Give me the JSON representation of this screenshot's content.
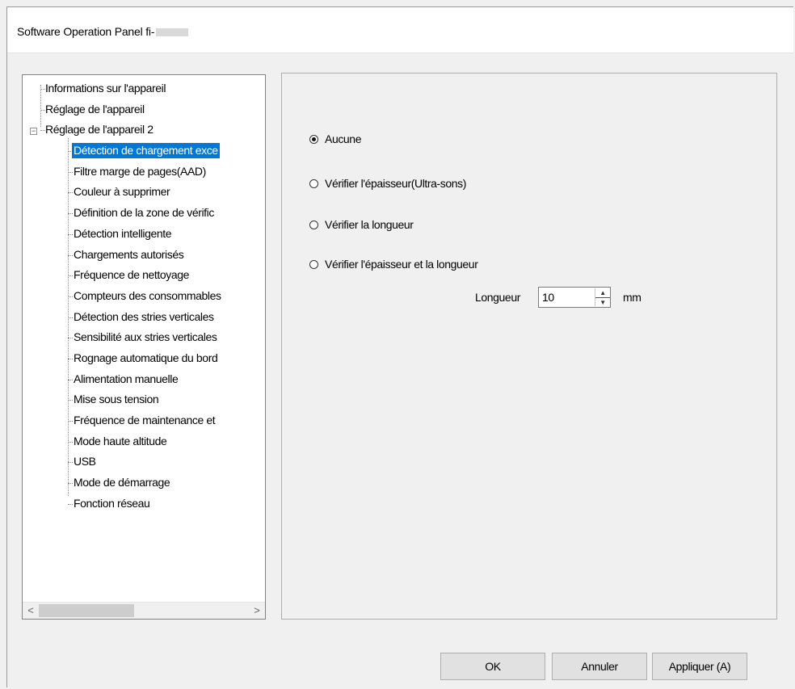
{
  "window": {
    "title": "Software Operation Panel fi-"
  },
  "tree": {
    "items": [
      {
        "label": "Informations sur l'appareil"
      },
      {
        "label": "Réglage de l'appareil"
      },
      {
        "label": "Réglage de l'appareil 2"
      },
      {
        "label": "Détection de chargement exce"
      },
      {
        "label": "Filtre marge de pages(AAD)"
      },
      {
        "label": "Couleur à supprimer"
      },
      {
        "label": "Définition de la zone de vérific"
      },
      {
        "label": "Détection intelligente"
      },
      {
        "label": "Chargements autorisés"
      },
      {
        "label": "Fréquence de nettoyage"
      },
      {
        "label": "Compteurs des consommables"
      },
      {
        "label": "Détection des stries verticales"
      },
      {
        "label": "Sensibilité aux stries verticales"
      },
      {
        "label": "Rognage automatique du bord"
      },
      {
        "label": "Alimentation manuelle"
      },
      {
        "label": "Mise sous tension"
      },
      {
        "label": "Fréquence de maintenance et"
      },
      {
        "label": "Mode haute altitude"
      },
      {
        "label": "USB"
      },
      {
        "label": "Mode de démarrage"
      },
      {
        "label": "Fonction réseau"
      }
    ],
    "selected_label": "Détection de chargement exce",
    "expander_symbol": "−",
    "scroll_left": "<",
    "scroll_right": ">"
  },
  "options": {
    "selected": "Aucune",
    "radios": [
      {
        "label": "Aucune"
      },
      {
        "label": "Vérifier l'épaisseur(Ultra-sons)"
      },
      {
        "label": "Vérifier la longueur"
      },
      {
        "label": "Vérifier l'épaisseur et la longueur"
      }
    ],
    "length_label": "Longueur",
    "length_value": "10",
    "length_unit": "mm"
  },
  "buttons": {
    "ok": "OK",
    "cancel": "Annuler",
    "apply": "Appliquer (A)"
  },
  "colors": {
    "selection": "#0078d7",
    "background": "#f0f0f0"
  }
}
